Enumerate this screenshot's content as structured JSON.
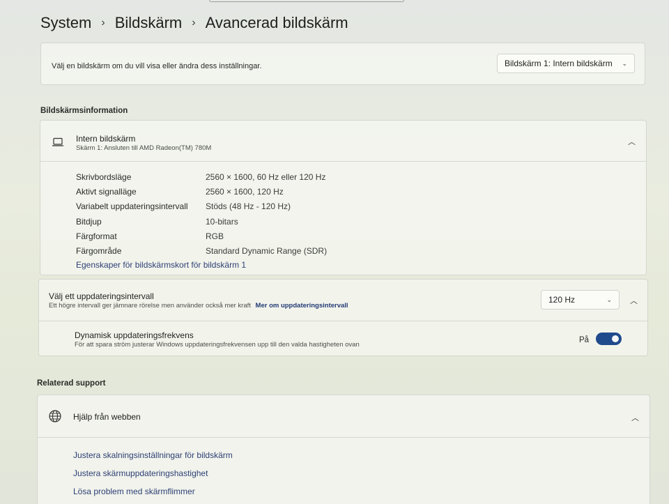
{
  "breadcrumb": {
    "root": "System",
    "middle": "Bildskärm",
    "current": "Avancerad bildskärm"
  },
  "display_select": {
    "prompt": "Välj en bildskärm om du vill visa eller ändra dess inställningar.",
    "selected": "Bildskärm 1: Intern bildskärm"
  },
  "display_info": {
    "section_title": "Bildskärmsinformation",
    "name": "Intern bildskärm",
    "subtitle": "Skärm 1: Ansluten till AMD Radeon(TM) 780M",
    "rows": [
      {
        "label": "Skrivbordsläge",
        "value": "2560 × 1600, 60 Hz eller 120 Hz"
      },
      {
        "label": "Aktivt signalläge",
        "value": "2560 × 1600, 120 Hz"
      },
      {
        "label": "Variabelt uppdateringsintervall",
        "value": "Stöds (48 Hz - 120 Hz)"
      },
      {
        "label": "Bitdjup",
        "value": "10-bitars"
      },
      {
        "label": "Färgformat",
        "value": "RGB"
      },
      {
        "label": "Färgområde",
        "value": "Standard Dynamic Range (SDR)"
      }
    ],
    "adapter_link": "Egenskaper för bildskärmskort för bildskärm 1"
  },
  "refresh_rate": {
    "title": "Välj ett uppdateringsintervall",
    "subtitle": "Ett högre intervall ger jämnare rörelse men använder också mer kraft",
    "learn_more": "Mer om uppdateringsintervall",
    "selected": "120 Hz",
    "dynamic_title": "Dynamisk uppdateringsfrekvens",
    "dynamic_subtitle": "För att spara ström justerar Windows uppdateringsfrekvensen upp till den valda hastigheten ovan",
    "toggle_label": "På",
    "toggle_on": true,
    "accent_color": "#1f4a8c"
  },
  "support": {
    "section_title": "Relaterad support",
    "header": "Hjälp från webben",
    "links": [
      "Justera skalningsinställningar för bildskärm",
      "Justera skärmuppdateringshastighet",
      "Lösa problem med skärmflimmer"
    ]
  }
}
